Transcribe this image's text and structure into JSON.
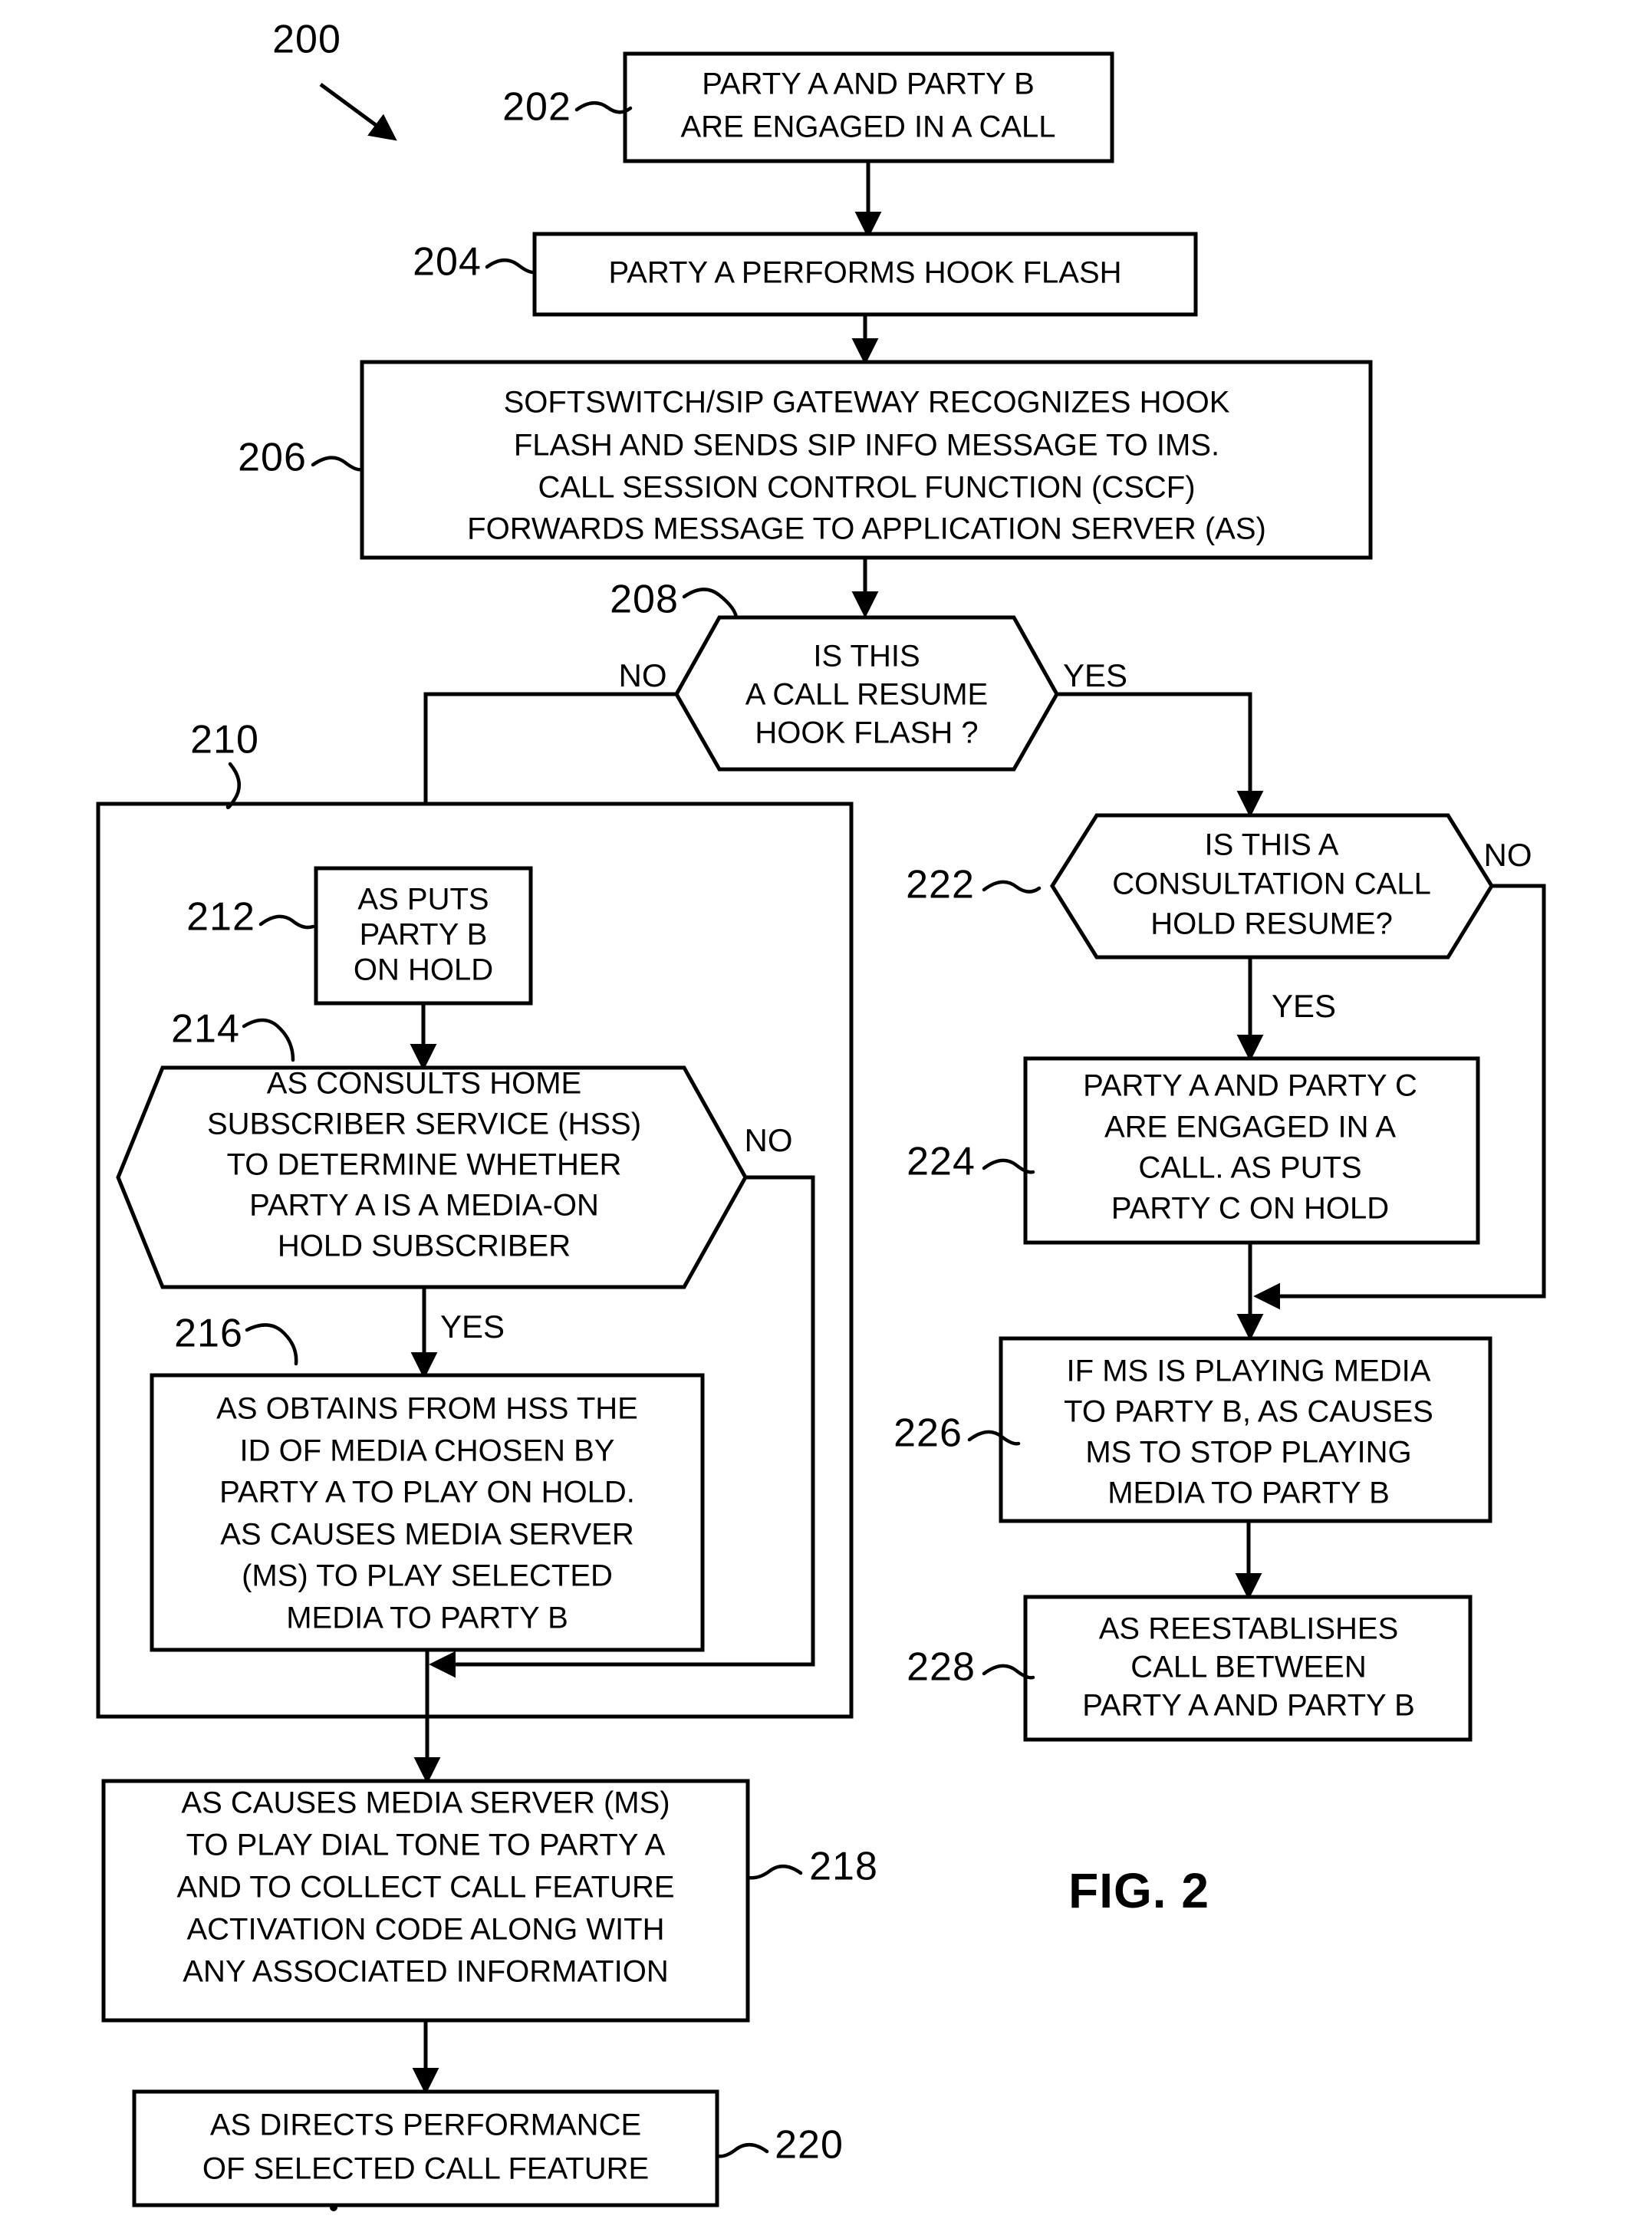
{
  "figure": {
    "label": "FIG. 2",
    "flow_ref": "200"
  },
  "nodes": {
    "n202": {
      "ref": "202",
      "shape": "rectangle",
      "lines": [
        "PARTY A AND PARTY B",
        "ARE ENGAGED IN A CALL"
      ]
    },
    "n204": {
      "ref": "204",
      "shape": "rectangle",
      "lines": [
        "PARTY A PERFORMS HOOK FLASH"
      ]
    },
    "n206": {
      "ref": "206",
      "shape": "rectangle",
      "lines": [
        "SOFTSWITCH/SIP GATEWAY RECOGNIZES HOOK",
        "FLASH AND SENDS SIP INFO MESSAGE TO IMS.",
        "CALL SESSION CONTROL FUNCTION (CSCF)",
        "FORWARDS MESSAGE TO APPLICATION SERVER (AS)"
      ]
    },
    "n208": {
      "ref": "208",
      "shape": "hexagon-decision",
      "lines": [
        "IS THIS",
        "A CALL RESUME",
        "HOOK FLASH ?"
      ],
      "branch_left": "NO",
      "branch_right": "YES"
    },
    "n210": {
      "ref": "210",
      "shape": "group-rectangle",
      "lines": []
    },
    "n212": {
      "ref": "212",
      "shape": "rectangle",
      "lines": [
        "AS PUTS",
        "PARTY B",
        "ON HOLD"
      ]
    },
    "n214": {
      "ref": "214",
      "shape": "hexagon-decision",
      "lines": [
        "AS CONSULTS HOME",
        "SUBSCRIBER SERVICE (HSS)",
        "TO DETERMINE WHETHER",
        "PARTY A IS A MEDIA-ON",
        "HOLD SUBSCRIBER"
      ],
      "branch_right": "NO",
      "branch_down": "YES"
    },
    "n216": {
      "ref": "216",
      "shape": "rectangle",
      "lines": [
        "AS OBTAINS FROM HSS THE",
        "ID OF MEDIA CHOSEN BY",
        "PARTY A TO PLAY ON HOLD.",
        "AS CAUSES MEDIA SERVER",
        "(MS) TO PLAY SELECTED",
        "MEDIA TO PARTY B"
      ]
    },
    "n218": {
      "ref": "218",
      "shape": "rectangle",
      "lines": [
        "AS CAUSES MEDIA SERVER (MS)",
        "TO PLAY DIAL TONE TO PARTY A",
        "AND TO COLLECT CALL FEATURE",
        "ACTIVATION CODE ALONG WITH",
        "ANY ASSOCIATED INFORMATION"
      ]
    },
    "n220": {
      "ref": "220",
      "shape": "rectangle",
      "lines": [
        "AS DIRECTS PERFORMANCE",
        "OF SELECTED CALL FEATURE"
      ]
    },
    "n222": {
      "ref": "222",
      "shape": "hexagon-decision",
      "lines": [
        "IS THIS A",
        "CONSULTATION CALL",
        "HOLD RESUME?"
      ],
      "branch_right": "NO",
      "branch_down": "YES"
    },
    "n224": {
      "ref": "224",
      "shape": "rectangle",
      "lines": [
        "PARTY A AND PARTY C",
        "ARE ENGAGED IN A",
        "CALL.  AS PUTS",
        "PARTY C ON HOLD"
      ]
    },
    "n226": {
      "ref": "226",
      "shape": "rectangle",
      "lines": [
        "IF MS IS PLAYING MEDIA",
        "TO PARTY B, AS CAUSES",
        "MS TO STOP PLAYING",
        "MEDIA TO PARTY B"
      ]
    },
    "n228": {
      "ref": "228",
      "shape": "rectangle",
      "lines": [
        "AS REESTABLISHES",
        "CALL BETWEEN",
        "PARTY A AND PARTY B"
      ]
    }
  },
  "branch_labels": {
    "d208_no": "NO",
    "d208_yes": "YES",
    "d214_no": "NO",
    "d214_yes": "YES",
    "d222_no": "NO",
    "d222_yes": "YES"
  },
  "colors": {
    "ink": "#000000",
    "paper": "#ffffff"
  }
}
